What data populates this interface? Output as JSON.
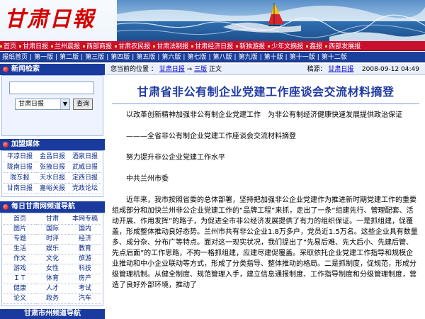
{
  "banner": {
    "logo_text": "甘肃日報"
  },
  "channel_bar": {
    "items": [
      "首页",
      "甘肃日报",
      "兰州晨报",
      "西部商报",
      "甘肃农民报",
      "甘肃法制报",
      "甘肃经济日报",
      "新独游报",
      "少年文摘报",
      "鑫报",
      "西部发展报"
    ]
  },
  "edition_bar": {
    "items": [
      "报纸首页",
      "第一版",
      "第二版",
      "第三版",
      "第四版",
      "第五版",
      "第六版",
      "第七版",
      "第八版",
      "第九版",
      "第十版",
      "第十一版",
      "第十二版"
    ]
  },
  "sidebar": {
    "search": {
      "title": "新闻检索",
      "input_value": "",
      "select_value": "甘肃日报",
      "button_label": "查询"
    },
    "media": {
      "title": "加盟媒体",
      "items": [
        "平凉日报",
        "金昌日报",
        "酒泉日报",
        "陇南日报",
        "张掖日报",
        "武威日报",
        "陇东报",
        "天水日报",
        "定西日报",
        "甘南日报",
        "嘉峪关报",
        "党政论坛"
      ]
    },
    "nav": {
      "title": "每日甘肃网频道导航",
      "items": [
        "首页",
        "甘肃",
        "本网专稿",
        "图片",
        "国际",
        "国内",
        "专题",
        "时评",
        "经济",
        "生活",
        "娱乐",
        "教育",
        "作文",
        "文化",
        "旅游",
        "游戏",
        "女性",
        "科技",
        "ＩＴ",
        "体育",
        "房产",
        "健康",
        "人才",
        "考试",
        "论文",
        "政务",
        "汽车"
      ]
    },
    "city_title": "甘肃市州频道导航"
  },
  "main": {
    "location_label": "您当前的位置 ：",
    "crumbs": [
      "甘肃日报",
      "三版"
    ],
    "crumb_sep": "→",
    "crumb_tail": "正文",
    "source_label": "稿源：",
    "source_link": "甘肃日报",
    "datetime": "2008-09-12 04:49",
    "headline": "甘肃省非公有制企业党建工作座谈会交流材料摘登",
    "paragraphs": [
      "以改革创新精神加强非公有制企业党建工作　为非公有制经济健康快速发展提供政治保证",
      "———全省非公有制企业党建工作座谈会交流材料摘登",
      "努力提升非公企业党建工作水平",
      "中共兰州市委",
      "近年来，我市按照省委的总体部署，坚持把加强非公企业党建作为推进新时期党建工作的重要组成部分和加快兰州非公企业党建工作的“品牌工程”来抓，走出了一条“组建先行、管理配套、活动开展、作用发挥”的路子，为促进全市非公经济发展提供了有力的组织保证。一是抓组建，促覆盖，形成整体推动良好态势。兰州市共有非公企业1.8万多户，党员近1.5万名。这些企业具有数量多、成分杂、分布广等特点。面对这一现实状况，我们提出了“先易后难、先大后小、先建后管、先点后面”的工作思路，不拘一格抓组建，应建尽建促覆盖。采取依托企业党建工作指导和规模企业推动和中小企业联动等方式，形成了分类指导、整体推动的格局。二是抓制度，促规范，形成分级管理机制。从健全制度、规范管理入手，建立信息通报制度、工作指导制度和分级管理制度，营造了良好外部环境，推动了"
    ]
  }
}
